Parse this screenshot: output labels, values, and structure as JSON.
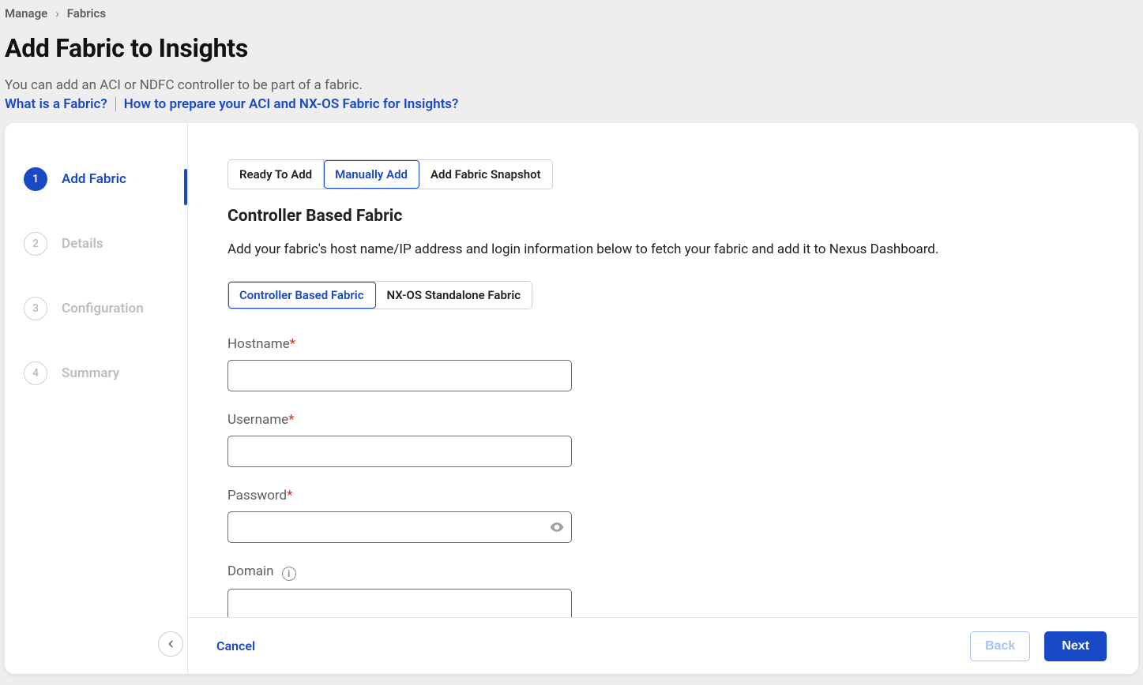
{
  "breadcrumb": {
    "item1": "Manage",
    "item2": "Fabrics"
  },
  "header": {
    "title": "Add Fabric to Insights",
    "description": "You can add an ACI or NDFC controller to be part of a fabric.",
    "link_fabric": "What is a Fabric?",
    "link_prepare": "How to prepare your ACI and NX-OS Fabric for Insights?"
  },
  "stepper": {
    "steps": [
      {
        "num": "1",
        "label": "Add Fabric",
        "state": "current"
      },
      {
        "num": "2",
        "label": "Details",
        "state": "inactive"
      },
      {
        "num": "3",
        "label": "Configuration",
        "state": "inactive"
      },
      {
        "num": "4",
        "label": "Summary",
        "state": "inactive"
      }
    ]
  },
  "tabs": {
    "ready": "Ready To Add",
    "manual": "Manually Add",
    "snapshot": "Add Fabric Snapshot"
  },
  "section": {
    "title": "Controller Based Fabric",
    "description": "Add your fabric's host name/IP address and login information below to fetch your fabric and add it to Nexus Dashboard."
  },
  "subtabs": {
    "controller": "Controller Based Fabric",
    "nxos": "NX-OS Standalone Fabric"
  },
  "form": {
    "hostname_label": "Hostname",
    "username_label": "Username",
    "password_label": "Password",
    "domain_label": "Domain",
    "required_mark": "*",
    "hostname_value": "",
    "username_value": "",
    "password_value": "",
    "domain_value": ""
  },
  "footer": {
    "cancel": "Cancel",
    "back": "Back",
    "next": "Next"
  }
}
